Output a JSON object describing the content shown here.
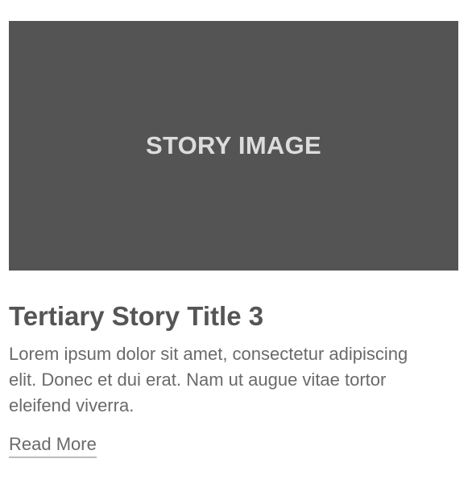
{
  "story": {
    "image_label": "STORY IMAGE",
    "title": "Tertiary Story Title 3",
    "body": "Lorem ipsum dolor sit amet, consectetur adipiscing elit. Donec et dui erat. Nam ut augue vitae tortor eleifend viverra.",
    "read_more_label": "Read More"
  },
  "colors": {
    "image_placeholder_bg": "#545454",
    "image_placeholder_text": "#dcdcdc",
    "title_text": "#555555",
    "body_text": "#6a6a6a",
    "link_underline": "#bcbcbc"
  }
}
